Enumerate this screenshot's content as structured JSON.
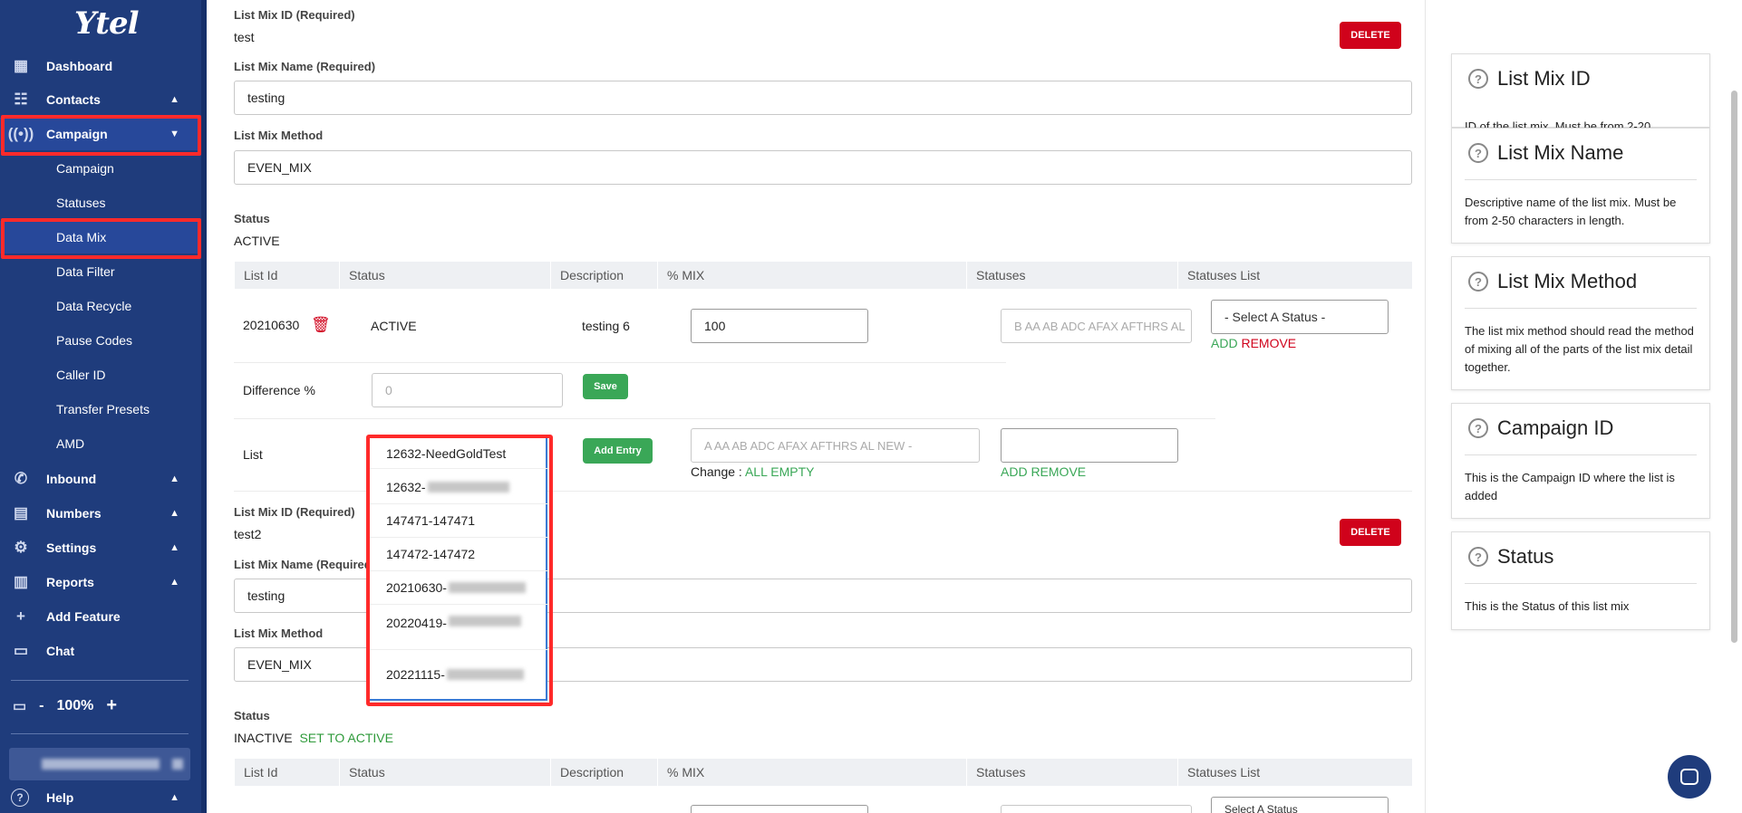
{
  "sidebar": {
    "logo": "Ytel",
    "nav": [
      {
        "label": "Dashboard",
        "icon": "dashboard-icon",
        "arrow": ""
      },
      {
        "label": "Contacts",
        "icon": "contacts-icon",
        "arrow": "▲"
      },
      {
        "label": "Campaign",
        "icon": "campaign-icon",
        "arrow": "▼"
      }
    ],
    "campaign_sub": [
      "Campaign",
      "Statuses",
      "Data Mix",
      "Data Filter",
      "Data Recycle",
      "Pause Codes",
      "Caller ID",
      "Transfer Presets",
      "AMD"
    ],
    "nav2": [
      {
        "label": "Inbound",
        "icon": "inbound-icon",
        "arrow": "▲"
      },
      {
        "label": "Numbers",
        "icon": "numbers-icon",
        "arrow": "▲"
      },
      {
        "label": "Settings",
        "icon": "settings-icon",
        "arrow": "▲"
      },
      {
        "label": "Reports",
        "icon": "reports-icon",
        "arrow": "▲"
      },
      {
        "label": "Add Feature",
        "icon": "plus-icon",
        "arrow": ""
      },
      {
        "label": "Chat",
        "icon": "chat-icon",
        "arrow": ""
      }
    ],
    "zoom": {
      "minus": "-",
      "value": "100%",
      "plus": "+"
    },
    "help": "Help"
  },
  "mix1": {
    "id_label": "List Mix ID (Required)",
    "id_value": "test",
    "delete_label": "DELETE",
    "name_label": "List Mix Name (Required)",
    "name_value": "testing",
    "method_label": "List Mix Method",
    "method_value": "EVEN_MIX",
    "status_label": "Status",
    "status_value": "ACTIVE",
    "columns": [
      "List Id",
      "Status",
      "Description",
      "% MIX",
      "Statuses",
      "Statuses List"
    ],
    "row": {
      "list_id": "20210630",
      "status": "ACTIVE",
      "description": "testing 6",
      "mix": "100",
      "statuses_placeholder": "B AA AB ADC AFAX AFTHRS AL",
      "select_status": "- Select A Status -",
      "add": "ADD",
      "remove": "REMOVE"
    },
    "difference_label": "Difference %",
    "difference_placeholder": "0",
    "save_label": "Save",
    "list_label": "List",
    "list_select_value": "12632-NeedGoldTest",
    "add_entry_label": "Add Entry",
    "list_statuses_placeholder": "A AA AB ADC AFAX AFTHRS AL NEW -",
    "change_label": "Change :",
    "all_empty": "ALL EMPTY",
    "add_remove": "ADD REMOVE"
  },
  "mix2": {
    "id_label": "List Mix ID (Required)",
    "id_value": "test2",
    "delete_label": "DELETE",
    "name_label": "List Mix Name (Required)",
    "name_value": "testing",
    "method_label": "List Mix Method",
    "method_value": "EVEN_MIX",
    "status_label": "Status",
    "status_value": "INACTIVE",
    "set_active": "SET TO ACTIVE",
    "columns": [
      "List Id",
      "Status",
      "Description",
      "% MIX",
      "Statuses",
      "Statuses List"
    ],
    "select_status": "Select A Status"
  },
  "dropdown_options": [
    "12632-",
    "147471-147471",
    "147472-147472",
    "20210630-",
    "20220419-",
    "20221115-"
  ],
  "help_cards": [
    {
      "title": "List Mix ID",
      "body": "ID of the list mix. Must be from 2-20"
    },
    {
      "title": "List Mix Name",
      "body": "Descriptive name of the list mix. Must be from 2-50 characters in length."
    },
    {
      "title": "List Mix Method",
      "body": "The list mix method should read the method of mixing all of the parts of the list mix detail together."
    },
    {
      "title": "Campaign ID",
      "body": "This is the Campaign ID where the list is added"
    },
    {
      "title": "Status",
      "body": "This is the Status of this list mix"
    }
  ],
  "colors": {
    "sidebar": "#1f3c7c",
    "highlight": "#ff2a2a",
    "delete": "#d0021b",
    "green": "#3aa757"
  }
}
